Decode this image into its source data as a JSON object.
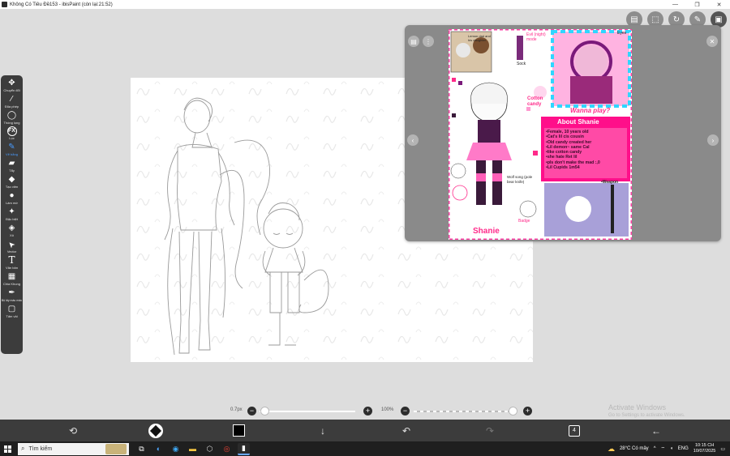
{
  "window": {
    "title": "Không Có Tiêu Đề153 - ibisPaint (còn lại:21:52)",
    "controls": [
      "—",
      "❐",
      "✕"
    ]
  },
  "toolbar": {
    "tools": [
      {
        "label": "Chuyển đổi",
        "icon": "move-icon",
        "glyph": "✥"
      },
      {
        "label": "Đũa phép",
        "icon": "magic-wand-icon",
        "glyph": "⁄"
      },
      {
        "label": "Thòng lọng",
        "icon": "lasso-icon",
        "glyph": "◯"
      },
      {
        "label": "Lọc",
        "icon": "filter-icon",
        "glyph": "FX"
      },
      {
        "label": "Vẽ bằng",
        "icon": "brush-icon",
        "glyph": "✎",
        "active": true
      },
      {
        "label": "Tẩy",
        "icon": "eraser-icon",
        "glyph": "▰"
      },
      {
        "label": "Tạo viền",
        "icon": "smudge-icon",
        "glyph": "◆"
      },
      {
        "label": "Làm mờ",
        "icon": "blur-icon",
        "glyph": "●"
      },
      {
        "label": "Đặc biệt",
        "icon": "special-icon",
        "glyph": "✦"
      },
      {
        "label": "Xô",
        "icon": "bucket-icon",
        "glyph": "◈"
      },
      {
        "label": "Vector",
        "icon": "vector-icon",
        "glyph": "➤"
      },
      {
        "label": "Văn bản",
        "icon": "text-icon",
        "glyph": "T"
      },
      {
        "label": "Chia Khung",
        "icon": "frame-divider-icon",
        "glyph": "▦"
      },
      {
        "label": "Bộ lấy màu màu",
        "icon": "eyedropper-icon",
        "glyph": "✒"
      },
      {
        "label": "Tấm vải",
        "icon": "canvas-icon",
        "glyph": "▢"
      }
    ]
  },
  "top_icons": [
    "layer-icon",
    "selection-icon",
    "transform-icon",
    "pen-icon",
    "reference-icon"
  ],
  "reference_window": {
    "text_lines": [
      "Lemon dad and his daughter",
      "Evil (night) mode",
      "Eyes",
      "Sock",
      "Cotton candy",
      "Wanna play?",
      "About Shanie",
      "•Female, 10 years old",
      "•Cat's lil cis cousin",
      "•Old candy created her",
      "•Lil demon~ same Cal",
      "•like cotton candy",
      "•she hate Ret lil",
      "•pls don't make the mad :,0",
      "•Lil Cupids 1m54",
      "•Weapon",
      "Wolf song (pole bear knife)",
      "Badge",
      "Shanie"
    ]
  },
  "sliders": {
    "brush_size": "0.7px",
    "opacity": "100%"
  },
  "watermark": {
    "line1": "Activate Windows",
    "line2": "Go to Settings to activate Windows."
  },
  "appbar": {
    "layer_count": "4"
  },
  "taskbar": {
    "search_placeholder": "Tìm kiếm",
    "weather": "28°C  Có mây",
    "language": "ENG",
    "time": "10:15 CH",
    "date": "10/07/2025"
  },
  "colors": {
    "toolbar_bg": "#3c3c3c",
    "active_tool": "#4a9cff",
    "workspace_bg": "#dddddd",
    "taskbar_bg": "#1f1f1f",
    "accent_pink": "#e6007e"
  }
}
